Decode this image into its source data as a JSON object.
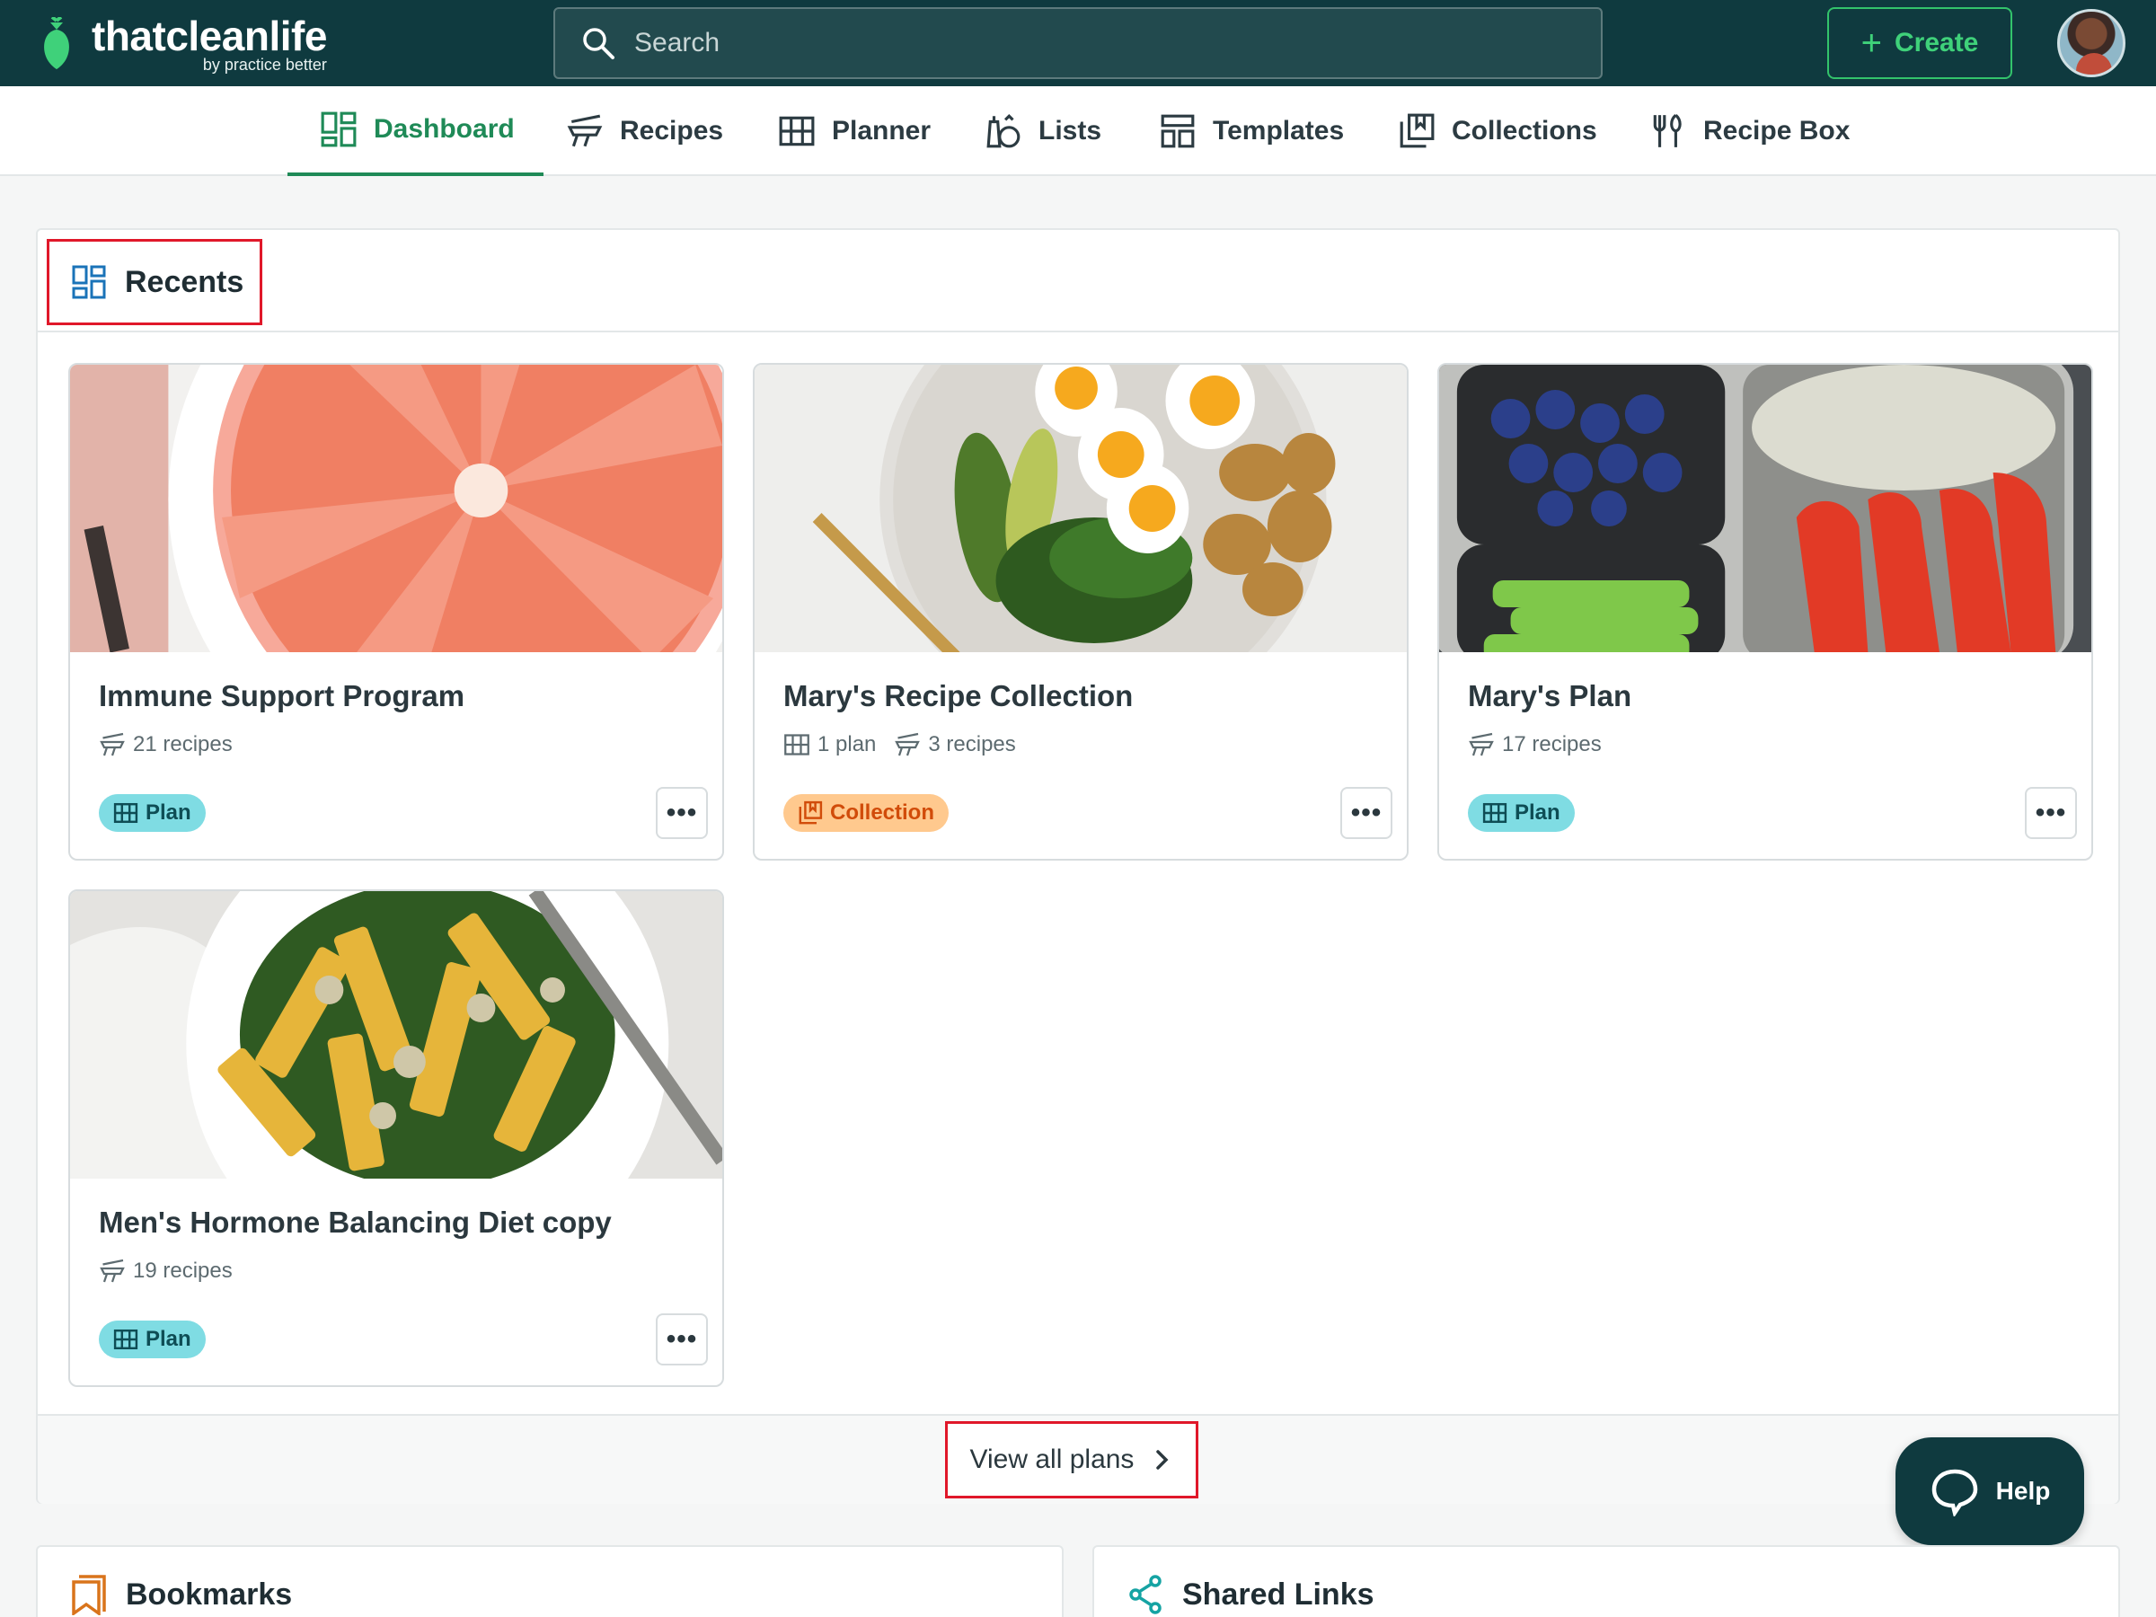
{
  "brand": {
    "name": "thatcleanlife",
    "by": "by practice better"
  },
  "search": {
    "placeholder": "Search"
  },
  "header": {
    "create_label": "Create"
  },
  "nav": {
    "tabs": [
      {
        "label": "Dashboard",
        "icon": "dashboard-icon"
      },
      {
        "label": "Recipes",
        "icon": "recipes-icon"
      },
      {
        "label": "Planner",
        "icon": "planner-icon"
      },
      {
        "label": "Lists",
        "icon": "lists-icon"
      },
      {
        "label": "Templates",
        "icon": "templates-icon"
      },
      {
        "label": "Collections",
        "icon": "collections-icon"
      },
      {
        "label": "Recipe Box",
        "icon": "recipe-box-icon"
      }
    ]
  },
  "recents": {
    "title": "Recents",
    "cards": [
      {
        "title": "Immune Support Program",
        "recipes": "21 recipes",
        "badge": "Plan",
        "image": "grapefruit"
      },
      {
        "title": "Mary's Recipe Collection",
        "plans": "1 plan",
        "recipes": "3 recipes",
        "badge": "Collection",
        "image": "eggs-potatoes-plate"
      },
      {
        "title": "Mary's Plan",
        "recipes": "17 recipes",
        "badge": "Plan",
        "image": "bento-box"
      },
      {
        "title": "Men's Hormone Balancing Diet copy",
        "recipes": "19 recipes",
        "badge": "Plan",
        "image": "penne-spinach"
      }
    ],
    "more_label": "•••",
    "view_all_label": "View all plans"
  },
  "help": {
    "label": "Help"
  },
  "bookmarks": {
    "title": "Bookmarks"
  },
  "shared_links": {
    "title": "Shared Links"
  },
  "colors": {
    "topbar": "#0f3a3f",
    "accent_green": "#1f8a57",
    "create_green": "#3fd17a",
    "plan_badge": "#7fdce3",
    "collection_badge": "#ffc98e",
    "highlight_red": "#e0182a"
  }
}
